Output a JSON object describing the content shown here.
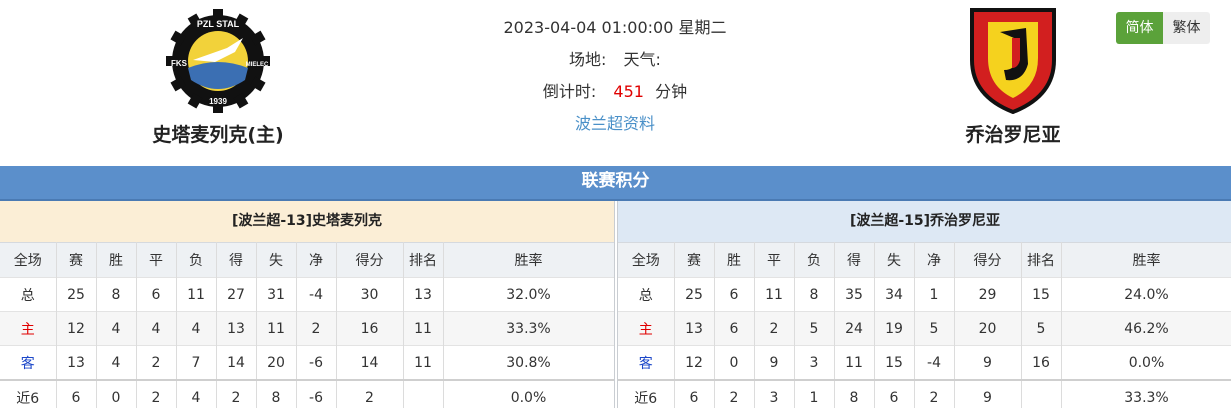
{
  "header": {
    "home_team": {
      "name": "史塔麦列克(主)",
      "logo_text": {
        "top": "PZL STAL",
        "left": "FKS",
        "right": "MIELEC",
        "year": "1939"
      }
    },
    "away_team": {
      "name": "乔治罗尼亚"
    },
    "match_time": "2023-04-04 01:00:00 星期二",
    "venue_label": "场地:",
    "weather_label": "天气:",
    "countdown_label": "倒计时:",
    "countdown_value": "451",
    "countdown_unit": "分钟",
    "league_link": "波兰超资料"
  },
  "lang": {
    "simplified": "简体",
    "traditional": "繁体"
  },
  "banner": "联赛积分",
  "columns": [
    "全场",
    "赛",
    "胜",
    "平",
    "负",
    "得",
    "失",
    "净",
    "得分",
    "排名",
    "胜率"
  ],
  "home_panel": {
    "title": "[波兰超-13]史塔麦列克",
    "rows": [
      [
        "总",
        "25",
        "8",
        "6",
        "11",
        "27",
        "31",
        "-4",
        "30",
        "13",
        "32.0%"
      ],
      [
        "主",
        "12",
        "4",
        "4",
        "4",
        "13",
        "11",
        "2",
        "16",
        "11",
        "33.3%"
      ],
      [
        "客",
        "13",
        "4",
        "2",
        "7",
        "14",
        "20",
        "-6",
        "14",
        "11",
        "30.8%"
      ],
      [
        "近6",
        "6",
        "0",
        "2",
        "4",
        "2",
        "8",
        "-6",
        "2",
        "",
        "0.0%"
      ]
    ]
  },
  "away_panel": {
    "title": "[波兰超-15]乔治罗尼亚",
    "rows": [
      [
        "总",
        "25",
        "6",
        "11",
        "8",
        "35",
        "34",
        "1",
        "29",
        "15",
        "24.0%"
      ],
      [
        "主",
        "13",
        "6",
        "2",
        "5",
        "24",
        "19",
        "5",
        "20",
        "5",
        "46.2%"
      ],
      [
        "客",
        "12",
        "0",
        "9",
        "3",
        "11",
        "15",
        "-4",
        "9",
        "16",
        "0.0%"
      ],
      [
        "近6",
        "6",
        "2",
        "3",
        "1",
        "8",
        "6",
        "2",
        "9",
        "",
        "33.3%"
      ]
    ]
  },
  "colors": {
    "banner": "#5b8fcb",
    "home_panel_bg": "#fbeed6",
    "away_panel_bg": "#dde8f4",
    "countdown": "#e00000",
    "active_lang": "#5ba23a"
  }
}
